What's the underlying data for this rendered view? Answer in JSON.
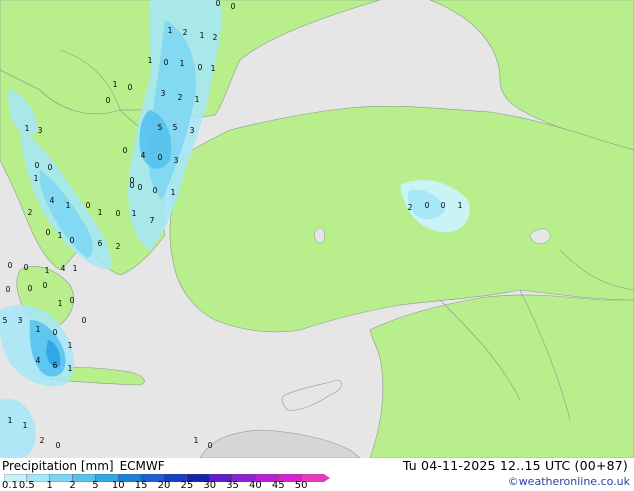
{
  "product": "Precipitation [mm]",
  "model": "ECMWF",
  "valid_time": "Tu 04-11-2025 12..15 UTC (00+87)",
  "credit": "©weatheronline.co.uk",
  "legend": {
    "ticks": [
      "0.1",
      "0.5",
      "1",
      "2",
      "5",
      "10",
      "15",
      "20",
      "25",
      "30",
      "35",
      "40",
      "45",
      "50"
    ],
    "colors": [
      "#c9f2fb",
      "#a4e6f8",
      "#7cd5f3",
      "#55c2ee",
      "#2fa8e3",
      "#1d7fd6",
      "#1c5fcf",
      "#173ec4",
      "#1524a8",
      "#5f1fc6",
      "#8e22d2",
      "#b623d6",
      "#d824cf",
      "#e83cc0"
    ]
  },
  "colors": {
    "land_forecast": "#b8ee8c",
    "land_outside": "#d6d6d6",
    "sea": "#e6e6e6",
    "border": "#8a9a8a"
  },
  "precip_labels": [
    "0",
    "0",
    "1",
    "2",
    "1",
    "2",
    "1",
    "0",
    "1",
    "0",
    "1",
    "1",
    "0",
    "0",
    "3",
    "2",
    "1",
    "5",
    "5",
    "3",
    "0",
    "4",
    "0",
    "3",
    "3",
    "1",
    "0",
    "0",
    "1",
    "4",
    "1",
    "0",
    "1",
    "0",
    "1",
    "2",
    "0",
    "1",
    "0",
    "7",
    "0",
    "0",
    "1",
    "4",
    "1",
    "0",
    "6",
    "2",
    "0",
    "0",
    "0",
    "1",
    "2",
    "0",
    "0",
    "1",
    "0",
    "0",
    "0",
    "1",
    "0",
    "0",
    "3",
    "5",
    "1",
    "0",
    "1",
    "4",
    "6",
    "1",
    "1",
    "1",
    "2",
    "0",
    "1",
    "0"
  ]
}
